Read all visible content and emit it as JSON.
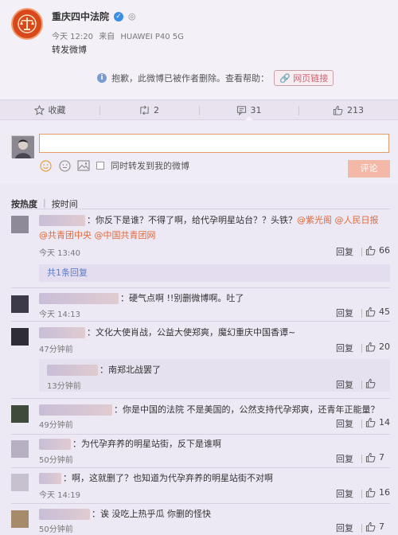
{
  "post": {
    "author": "重庆四中法院",
    "time": "今天 12:20",
    "source_prefix": "来自",
    "device": "HUAWEI P40 5G",
    "repost_text": "转发微博",
    "deleted_notice": "抱歉，此微博已被作者删除。查看帮助：",
    "web_link_label": "网页链接"
  },
  "actions": {
    "favorite_label": "收藏",
    "repost_count": "2",
    "comment_count": "31",
    "like_count": "213"
  },
  "compose": {
    "repost_checkbox_label": "同时转发到我的微博",
    "submit_label": "评论"
  },
  "sort": {
    "hot_label": "按热度",
    "time_label": "按时间"
  },
  "comments": [
    {
      "text": "：你反下是谁？不得了啊，给代孕明星站台？？头铁？",
      "mentions_1": "@紫光阁 @人民日报",
      "mentions_2": "@共青团中央 @中国共青团网",
      "time": "今天 13:40",
      "reply_label": "回复",
      "likes": "66",
      "more_replies": "共1条回复"
    },
    {
      "text": "：硬气点啊 !!别删微博啊。吐了",
      "time": "今天 14:13",
      "reply_label": "回复",
      "likes": "45"
    },
    {
      "text": "：文化大使肖战，公益大使郑爽，魔幻重庆中国香谭~",
      "time": "47分钟前",
      "reply_label": "回复",
      "likes": "20",
      "sub_reply_text": "：南郑北战罢了",
      "sub_reply_time": "13分钟前",
      "sub_reply_reply_label": "回复"
    },
    {
      "text": "：你是中国的法院 不是美国的，公然支持代孕郑爽，还青年正能量？",
      "time": "49分钟前",
      "reply_label": "回复",
      "likes": "14"
    },
    {
      "text": "：为代孕弃养的明星站街，反下是谁啊",
      "time": "50分钟前",
      "reply_label": "回复",
      "likes": "7"
    },
    {
      "text": "：啊，这就删了？也知道为代孕弃养的明星站街不对啊",
      "time": "今天 14:19",
      "reply_label": "回复",
      "likes": "16"
    },
    {
      "text": "：诶 没吃上热乎瓜 你删的怪快",
      "time": "50分钟前",
      "reply_label": "回复",
      "likes": "7"
    }
  ],
  "colors": {
    "accent_orange": "#e06a3a",
    "link_blue": "#5a7ac8",
    "submit_disabled": "#f3b8a8"
  },
  "icons": {
    "author_avatar": "court-emblem-icon",
    "verified": "verified-badge-icon",
    "info": "info-icon",
    "link": "link-icon",
    "favorite": "star-icon",
    "repost": "repost-icon",
    "comment": "comment-icon",
    "like": "thumbs-up-icon",
    "emoji": "emoji-icon",
    "image": "image-icon"
  }
}
